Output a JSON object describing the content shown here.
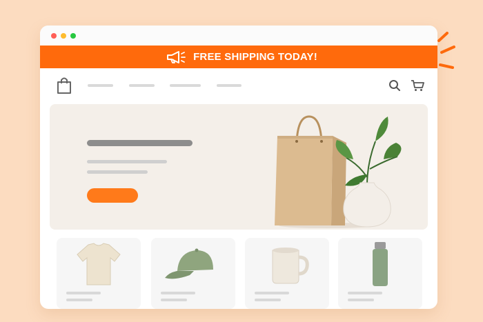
{
  "banner": {
    "text": "FREE SHIPPING TODAY!",
    "icon": "megaphone-icon",
    "color": "#ff6a0c"
  },
  "nav": {
    "logo_icon": "shopping-bag-icon",
    "search_icon": "search-icon",
    "cart_icon": "cart-icon"
  },
  "hero": {
    "cta_color": "#ff7a1a",
    "image": "shopping-bag-and-plant-vase"
  },
  "products": [
    {
      "image": "t-shirt"
    },
    {
      "image": "cap"
    },
    {
      "image": "mug"
    },
    {
      "image": "water-bottle"
    }
  ],
  "colors": {
    "background": "#fcdcc0",
    "accent": "#ff6a0c"
  }
}
